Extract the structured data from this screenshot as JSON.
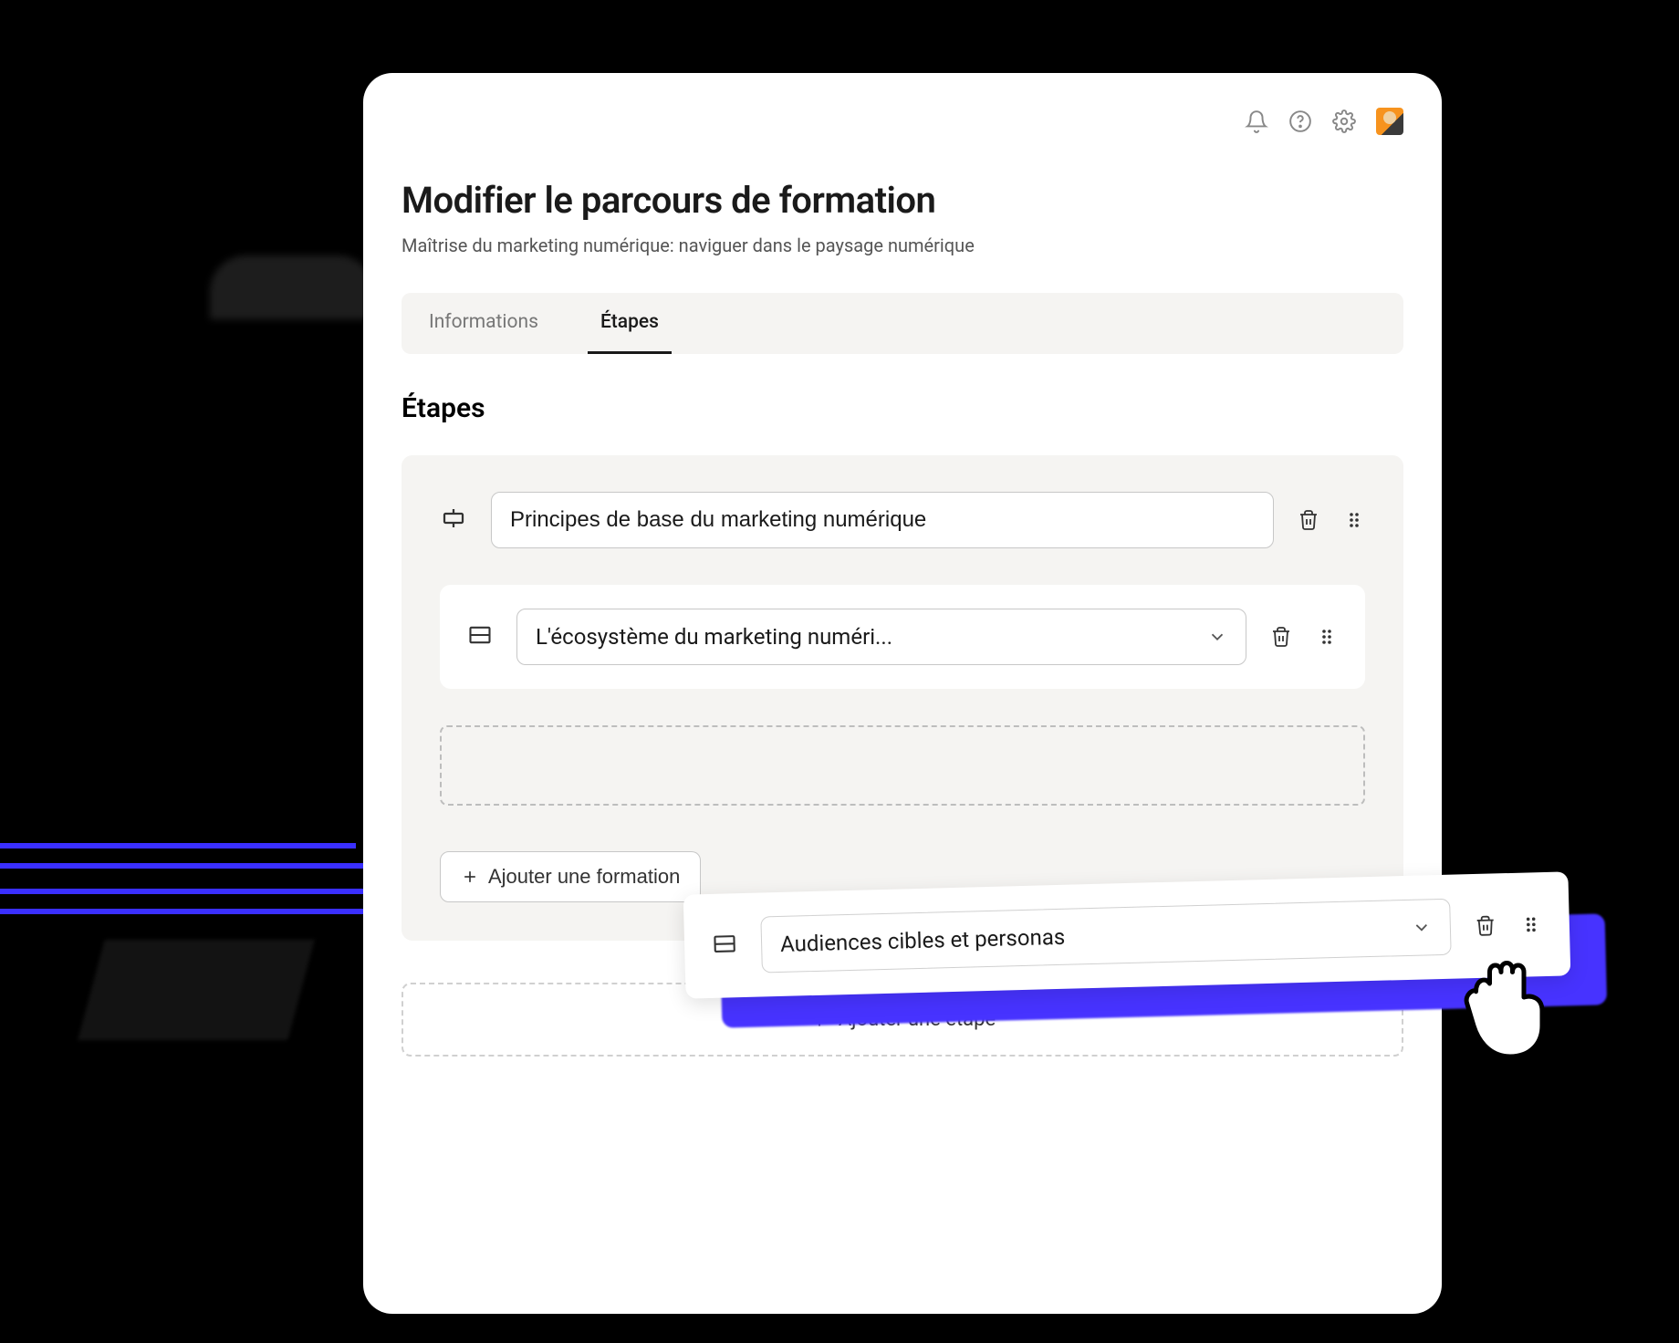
{
  "header": {
    "title": "Modifier le parcours de formation",
    "subtitle": "Maîtrise du marketing numérique: naviguer dans le paysage numérique"
  },
  "tabs": {
    "info": "Informations",
    "steps": "Étapes"
  },
  "section": {
    "title": "Étapes"
  },
  "step": {
    "name": "Principes de base du marketing numérique",
    "course1": "L'écosystème du marketing numéri...",
    "course2_dragged": "Audiences cibles et personas"
  },
  "buttons": {
    "add_course": "Ajouter une formation",
    "add_step": "Ajouter une étape"
  }
}
